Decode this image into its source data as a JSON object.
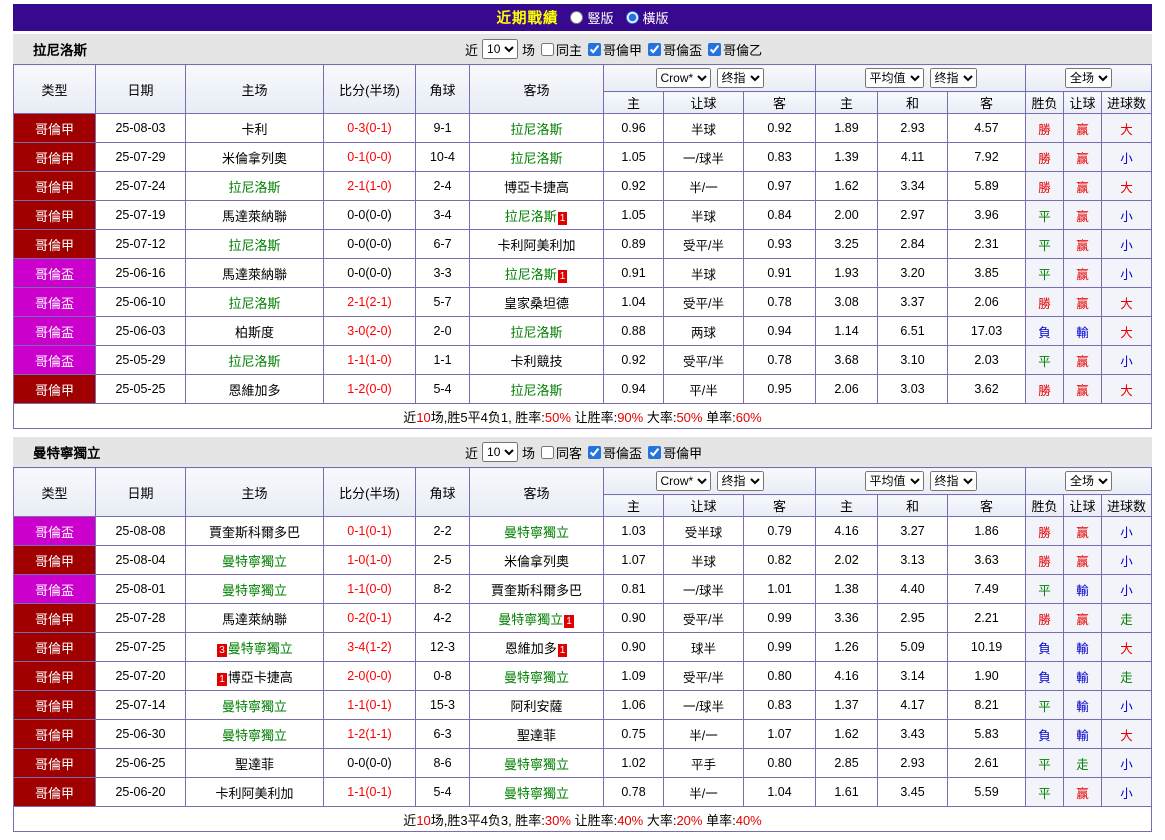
{
  "page": {
    "title": "近期戰績",
    "view_modes": [
      {
        "label": "豎版",
        "selected": false
      },
      {
        "label": "橫版",
        "selected": true
      }
    ]
  },
  "colors": {
    "topbar_bg": "#37098e",
    "title_text": "#ffff00",
    "border": "#7a6cb0",
    "band_bg": "#e5e5e5",
    "shade_bg": "#f3f3fa",
    "focus_team": "#008000",
    "red": "#e60000",
    "green": "#008000",
    "blue": "#0000cc",
    "score_red": "#ff0000",
    "league": {
      "哥倫甲": "#a00000",
      "哥倫盃": "#cc00cc"
    }
  },
  "header_labels": {
    "type": "类型",
    "date": "日期",
    "home": "主场",
    "score": "比分(半场)",
    "corner": "角球",
    "away": "客场",
    "group1_selects": [
      "Crow*",
      "终指"
    ],
    "group1_cols": [
      "主",
      "让球",
      "客"
    ],
    "group2_selects": [
      "平均值",
      "终指"
    ],
    "group2_cols": [
      "主",
      "和",
      "客"
    ],
    "group3_selects": [
      "全场"
    ],
    "group3_cols": [
      "胜负",
      "让球",
      "进球数"
    ]
  },
  "tables": [
    {
      "team": "拉尼洛斯",
      "controls": {
        "prefix": "近",
        "count": "10",
        "suffix": "场",
        "checkboxes": [
          {
            "label": "同主",
            "checked": false
          },
          {
            "label": "哥倫甲",
            "checked": true
          },
          {
            "label": "哥倫盃",
            "checked": true
          },
          {
            "label": "哥倫乙",
            "checked": true
          }
        ]
      },
      "rows": [
        {
          "league": "哥倫甲",
          "date": "25-08-03",
          "home": {
            "name": "卡利"
          },
          "score": {
            "text": "0-3(0-1)",
            "red": true
          },
          "corner": "9-1",
          "away": {
            "name": "拉尼洛斯",
            "focus": true
          },
          "odds1": [
            "0.96",
            "半球",
            "0.92"
          ],
          "odds2": [
            "1.89",
            "2.93",
            "4.57"
          ],
          "res": [
            {
              "t": "勝",
              "c": "red"
            },
            {
              "t": "赢",
              "c": "red"
            },
            {
              "t": "大",
              "c": "red"
            }
          ]
        },
        {
          "league": "哥倫甲",
          "date": "25-07-29",
          "home": {
            "name": "米倫拿列奧"
          },
          "score": {
            "text": "0-1(0-0)",
            "red": true
          },
          "corner": "10-4",
          "away": {
            "name": "拉尼洛斯",
            "focus": true
          },
          "odds1": [
            "1.05",
            "一/球半",
            "0.83"
          ],
          "odds2": [
            "1.39",
            "4.11",
            "7.92"
          ],
          "res": [
            {
              "t": "勝",
              "c": "red"
            },
            {
              "t": "赢",
              "c": "red"
            },
            {
              "t": "小",
              "c": "blue"
            }
          ]
        },
        {
          "league": "哥倫甲",
          "date": "25-07-24",
          "home": {
            "name": "拉尼洛斯",
            "focus": true
          },
          "score": {
            "text": "2-1(1-0)",
            "red": true
          },
          "corner": "2-4",
          "away": {
            "name": "博亞卡捷高"
          },
          "odds1": [
            "0.92",
            "半/一",
            "0.97"
          ],
          "odds2": [
            "1.62",
            "3.34",
            "5.89"
          ],
          "res": [
            {
              "t": "勝",
              "c": "red"
            },
            {
              "t": "赢",
              "c": "red"
            },
            {
              "t": "大",
              "c": "red"
            }
          ]
        },
        {
          "league": "哥倫甲",
          "date": "25-07-19",
          "home": {
            "name": "馬達萊納聯"
          },
          "score": {
            "text": "0-0(0-0)",
            "red": false
          },
          "corner": "3-4",
          "away": {
            "name": "拉尼洛斯",
            "focus": true,
            "post": "1"
          },
          "odds1": [
            "1.05",
            "半球",
            "0.84"
          ],
          "odds2": [
            "2.00",
            "2.97",
            "3.96"
          ],
          "res": [
            {
              "t": "平",
              "c": "green"
            },
            {
              "t": "赢",
              "c": "red"
            },
            {
              "t": "小",
              "c": "blue"
            }
          ]
        },
        {
          "league": "哥倫甲",
          "date": "25-07-12",
          "home": {
            "name": "拉尼洛斯",
            "focus": true
          },
          "score": {
            "text": "0-0(0-0)",
            "red": false
          },
          "corner": "6-7",
          "away": {
            "name": "卡利阿美利加"
          },
          "odds1": [
            "0.89",
            "受平/半",
            "0.93"
          ],
          "odds2": [
            "3.25",
            "2.84",
            "2.31"
          ],
          "res": [
            {
              "t": "平",
              "c": "green"
            },
            {
              "t": "赢",
              "c": "red"
            },
            {
              "t": "小",
              "c": "blue"
            }
          ]
        },
        {
          "league": "哥倫盃",
          "date": "25-06-16",
          "home": {
            "name": "馬達萊納聯"
          },
          "score": {
            "text": "0-0(0-0)",
            "red": false
          },
          "corner": "3-3",
          "away": {
            "name": "拉尼洛斯",
            "focus": true,
            "post": "1"
          },
          "odds1": [
            "0.91",
            "半球",
            "0.91"
          ],
          "odds2": [
            "1.93",
            "3.20",
            "3.85"
          ],
          "res": [
            {
              "t": "平",
              "c": "green"
            },
            {
              "t": "赢",
              "c": "red"
            },
            {
              "t": "小",
              "c": "blue"
            }
          ]
        },
        {
          "league": "哥倫盃",
          "date": "25-06-10",
          "home": {
            "name": "拉尼洛斯",
            "focus": true
          },
          "score": {
            "text": "2-1(2-1)",
            "red": true
          },
          "corner": "5-7",
          "away": {
            "name": "皇家桑坦德"
          },
          "odds1": [
            "1.04",
            "受平/半",
            "0.78"
          ],
          "odds2": [
            "3.08",
            "3.37",
            "2.06"
          ],
          "res": [
            {
              "t": "勝",
              "c": "red"
            },
            {
              "t": "赢",
              "c": "red"
            },
            {
              "t": "大",
              "c": "red"
            }
          ]
        },
        {
          "league": "哥倫盃",
          "date": "25-06-03",
          "home": {
            "name": "柏斯度"
          },
          "score": {
            "text": "3-0(2-0)",
            "red": true
          },
          "corner": "2-0",
          "away": {
            "name": "拉尼洛斯",
            "focus": true
          },
          "odds1": [
            "0.88",
            "两球",
            "0.94"
          ],
          "odds2": [
            "1.14",
            "6.51",
            "17.03"
          ],
          "res": [
            {
              "t": "負",
              "c": "blue"
            },
            {
              "t": "輸",
              "c": "blue"
            },
            {
              "t": "大",
              "c": "red"
            }
          ]
        },
        {
          "league": "哥倫盃",
          "date": "25-05-29",
          "home": {
            "name": "拉尼洛斯",
            "focus": true
          },
          "score": {
            "text": "1-1(1-0)",
            "red": true
          },
          "corner": "1-1",
          "away": {
            "name": "卡利競技"
          },
          "odds1": [
            "0.92",
            "受平/半",
            "0.78"
          ],
          "odds2": [
            "3.68",
            "3.10",
            "2.03"
          ],
          "res": [
            {
              "t": "平",
              "c": "green"
            },
            {
              "t": "赢",
              "c": "red"
            },
            {
              "t": "小",
              "c": "blue"
            }
          ]
        },
        {
          "league": "哥倫甲",
          "date": "25-05-25",
          "home": {
            "name": "恩維加多"
          },
          "score": {
            "text": "1-2(0-0)",
            "red": true
          },
          "corner": "5-4",
          "away": {
            "name": "拉尼洛斯",
            "focus": true
          },
          "odds1": [
            "0.94",
            "平/半",
            "0.95"
          ],
          "odds2": [
            "2.06",
            "3.03",
            "3.62"
          ],
          "res": [
            {
              "t": "勝",
              "c": "red"
            },
            {
              "t": "赢",
              "c": "red"
            },
            {
              "t": "大",
              "c": "red"
            }
          ]
        }
      ],
      "summary": [
        {
          "t": "近"
        },
        {
          "t": "10",
          "red": true
        },
        {
          "t": "场,胜5平4负1, 胜率:"
        },
        {
          "t": "50%",
          "red": true
        },
        {
          "t": " 让胜率:"
        },
        {
          "t": "90%",
          "red": true
        },
        {
          "t": " 大率:"
        },
        {
          "t": "50%",
          "red": true
        },
        {
          "t": " 单率:"
        },
        {
          "t": "60%",
          "red": true
        }
      ]
    },
    {
      "team": "曼特寧獨立",
      "controls": {
        "prefix": "近",
        "count": "10",
        "suffix": "场",
        "checkboxes": [
          {
            "label": "同客",
            "checked": false
          },
          {
            "label": "哥倫盃",
            "checked": true
          },
          {
            "label": "哥倫甲",
            "checked": true
          }
        ]
      },
      "rows": [
        {
          "league": "哥倫盃",
          "date": "25-08-08",
          "home": {
            "name": "賈奎斯科爾多巴"
          },
          "score": {
            "text": "0-1(0-1)",
            "red": true
          },
          "corner": "2-2",
          "away": {
            "name": "曼特寧獨立",
            "focus": true
          },
          "odds1": [
            "1.03",
            "受半球",
            "0.79"
          ],
          "odds2": [
            "4.16",
            "3.27",
            "1.86"
          ],
          "res": [
            {
              "t": "勝",
              "c": "red"
            },
            {
              "t": "赢",
              "c": "red"
            },
            {
              "t": "小",
              "c": "blue"
            }
          ]
        },
        {
          "league": "哥倫甲",
          "date": "25-08-04",
          "home": {
            "name": "曼特寧獨立",
            "focus": true
          },
          "score": {
            "text": "1-0(1-0)",
            "red": true
          },
          "corner": "2-5",
          "away": {
            "name": "米倫拿列奧"
          },
          "odds1": [
            "1.07",
            "半球",
            "0.82"
          ],
          "odds2": [
            "2.02",
            "3.13",
            "3.63"
          ],
          "res": [
            {
              "t": "勝",
              "c": "red"
            },
            {
              "t": "赢",
              "c": "red"
            },
            {
              "t": "小",
              "c": "blue"
            }
          ]
        },
        {
          "league": "哥倫盃",
          "date": "25-08-01",
          "home": {
            "name": "曼特寧獨立",
            "focus": true
          },
          "score": {
            "text": "1-1(0-0)",
            "red": true
          },
          "corner": "8-2",
          "away": {
            "name": "賈奎斯科爾多巴"
          },
          "odds1": [
            "0.81",
            "一/球半",
            "1.01"
          ],
          "odds2": [
            "1.38",
            "4.40",
            "7.49"
          ],
          "res": [
            {
              "t": "平",
              "c": "green"
            },
            {
              "t": "輸",
              "c": "blue"
            },
            {
              "t": "小",
              "c": "blue"
            }
          ]
        },
        {
          "league": "哥倫甲",
          "date": "25-07-28",
          "home": {
            "name": "馬達萊納聯"
          },
          "score": {
            "text": "0-2(0-1)",
            "red": true
          },
          "corner": "4-2",
          "away": {
            "name": "曼特寧獨立",
            "focus": true,
            "post": "1"
          },
          "odds1": [
            "0.90",
            "受平/半",
            "0.99"
          ],
          "odds2": [
            "3.36",
            "2.95",
            "2.21"
          ],
          "res": [
            {
              "t": "勝",
              "c": "red"
            },
            {
              "t": "赢",
              "c": "red"
            },
            {
              "t": "走",
              "c": "green"
            }
          ]
        },
        {
          "league": "哥倫甲",
          "date": "25-07-25",
          "home": {
            "name": "曼特寧獨立",
            "focus": true,
            "pre": "3"
          },
          "score": {
            "text": "3-4(1-2)",
            "red": true
          },
          "corner": "12-3",
          "away": {
            "name": "恩維加多",
            "post": "1"
          },
          "odds1": [
            "0.90",
            "球半",
            "0.99"
          ],
          "odds2": [
            "1.26",
            "5.09",
            "10.19"
          ],
          "res": [
            {
              "t": "負",
              "c": "blue"
            },
            {
              "t": "輸",
              "c": "blue"
            },
            {
              "t": "大",
              "c": "red"
            }
          ]
        },
        {
          "league": "哥倫甲",
          "date": "25-07-20",
          "home": {
            "name": "博亞卡捷高",
            "pre": "1"
          },
          "score": {
            "text": "2-0(0-0)",
            "red": true
          },
          "corner": "0-8",
          "away": {
            "name": "曼特寧獨立",
            "focus": true
          },
          "odds1": [
            "1.09",
            "受平/半",
            "0.80"
          ],
          "odds2": [
            "4.16",
            "3.14",
            "1.90"
          ],
          "res": [
            {
              "t": "負",
              "c": "blue"
            },
            {
              "t": "輸",
              "c": "blue"
            },
            {
              "t": "走",
              "c": "green"
            }
          ]
        },
        {
          "league": "哥倫甲",
          "date": "25-07-14",
          "home": {
            "name": "曼特寧獨立",
            "focus": true
          },
          "score": {
            "text": "1-1(0-1)",
            "red": true
          },
          "corner": "15-3",
          "away": {
            "name": "阿利安薩"
          },
          "odds1": [
            "1.06",
            "一/球半",
            "0.83"
          ],
          "odds2": [
            "1.37",
            "4.17",
            "8.21"
          ],
          "res": [
            {
              "t": "平",
              "c": "green"
            },
            {
              "t": "輸",
              "c": "blue"
            },
            {
              "t": "小",
              "c": "blue"
            }
          ]
        },
        {
          "league": "哥倫甲",
          "date": "25-06-30",
          "home": {
            "name": "曼特寧獨立",
            "focus": true
          },
          "score": {
            "text": "1-2(1-1)",
            "red": true
          },
          "corner": "6-3",
          "away": {
            "name": "聖達菲"
          },
          "odds1": [
            "0.75",
            "半/一",
            "1.07"
          ],
          "odds2": [
            "1.62",
            "3.43",
            "5.83"
          ],
          "res": [
            {
              "t": "負",
              "c": "blue"
            },
            {
              "t": "輸",
              "c": "blue"
            },
            {
              "t": "大",
              "c": "red"
            }
          ]
        },
        {
          "league": "哥倫甲",
          "date": "25-06-25",
          "home": {
            "name": "聖達菲"
          },
          "score": {
            "text": "0-0(0-0)",
            "red": false
          },
          "corner": "8-6",
          "away": {
            "name": "曼特寧獨立",
            "focus": true
          },
          "odds1": [
            "1.02",
            "平手",
            "0.80"
          ],
          "odds2": [
            "2.85",
            "2.93",
            "2.61"
          ],
          "res": [
            {
              "t": "平",
              "c": "green"
            },
            {
              "t": "走",
              "c": "green"
            },
            {
              "t": "小",
              "c": "blue"
            }
          ]
        },
        {
          "league": "哥倫甲",
          "date": "25-06-20",
          "home": {
            "name": "卡利阿美利加"
          },
          "score": {
            "text": "1-1(0-1)",
            "red": true
          },
          "corner": "5-4",
          "away": {
            "name": "曼特寧獨立",
            "focus": true
          },
          "odds1": [
            "0.78",
            "半/一",
            "1.04"
          ],
          "odds2": [
            "1.61",
            "3.45",
            "5.59"
          ],
          "res": [
            {
              "t": "平",
              "c": "green"
            },
            {
              "t": "赢",
              "c": "red"
            },
            {
              "t": "小",
              "c": "blue"
            }
          ]
        }
      ],
      "summary": [
        {
          "t": "近"
        },
        {
          "t": "10",
          "red": true
        },
        {
          "t": "场,胜3平4负3, 胜率:"
        },
        {
          "t": "30%",
          "red": true
        },
        {
          "t": " 让胜率:"
        },
        {
          "t": "40%",
          "red": true
        },
        {
          "t": " 大率:"
        },
        {
          "t": "20%",
          "red": true
        },
        {
          "t": " 单率:"
        },
        {
          "t": "40%",
          "red": true
        }
      ]
    }
  ]
}
